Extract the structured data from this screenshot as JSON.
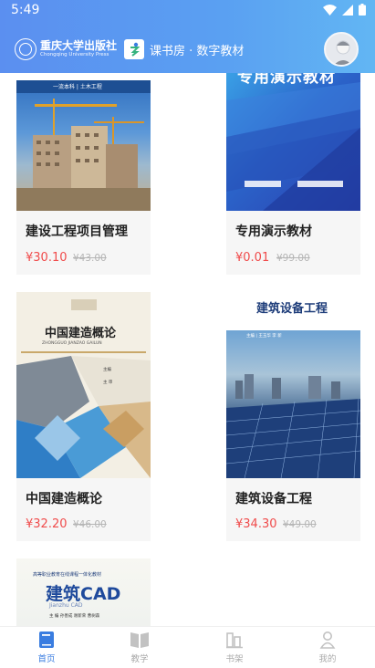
{
  "status": {
    "time": "5:49",
    "icons": [
      "wifi-icon",
      "signal-icon",
      "battery-icon"
    ]
  },
  "header": {
    "publisher_name": "重庆大学出版社",
    "publisher_en": "Chongqing University Press",
    "app_name": "课书房 · 数字教材"
  },
  "books": [
    {
      "title": "建设工程项目管理",
      "price": "¥30.10",
      "original_price": "¥43.00",
      "cover_topline": "一流本科 | 土木工程"
    },
    {
      "title": "专用演示教材",
      "price": "¥0.01",
      "original_price": "¥99.00",
      "cover_heading": "专用演示教材"
    },
    {
      "title": "中国建造概论",
      "price": "¥32.20",
      "original_price": "¥46.00",
      "cover_heading": "中国建造概论",
      "cover_pinyin": "ZHONGGUO JIANZAO GAILUN",
      "cover_editors": [
        "主编  ",
        "主 审  "
      ]
    },
    {
      "title": "建筑设备工程",
      "price": "¥34.30",
      "original_price": "¥49.00",
      "cover_heading": "建筑设备工程",
      "cover_authors": "主编 | 王玉华 李 新"
    },
    {
      "title": "建筑CAD",
      "cover_series": "高等职业教育在线课程一体化教材",
      "cover_heading": "建筑CAD",
      "cover_subtitle": "Jianzhu CAD",
      "cover_authors": "主 编  孙善成  谢新荣  曹树森"
    }
  ],
  "tabs": [
    {
      "label": "首页",
      "icon": "home-book-icon",
      "active": true
    },
    {
      "label": "教学",
      "icon": "open-book-icon",
      "active": false
    },
    {
      "label": "书架",
      "icon": "bookshelf-icon",
      "active": false
    },
    {
      "label": "我的",
      "icon": "person-icon",
      "active": false
    }
  ],
  "colors": {
    "accent": "#3a7de0",
    "price": "#f04b4b",
    "header_start": "#5b8ff0",
    "header_end": "#62b6f3"
  }
}
